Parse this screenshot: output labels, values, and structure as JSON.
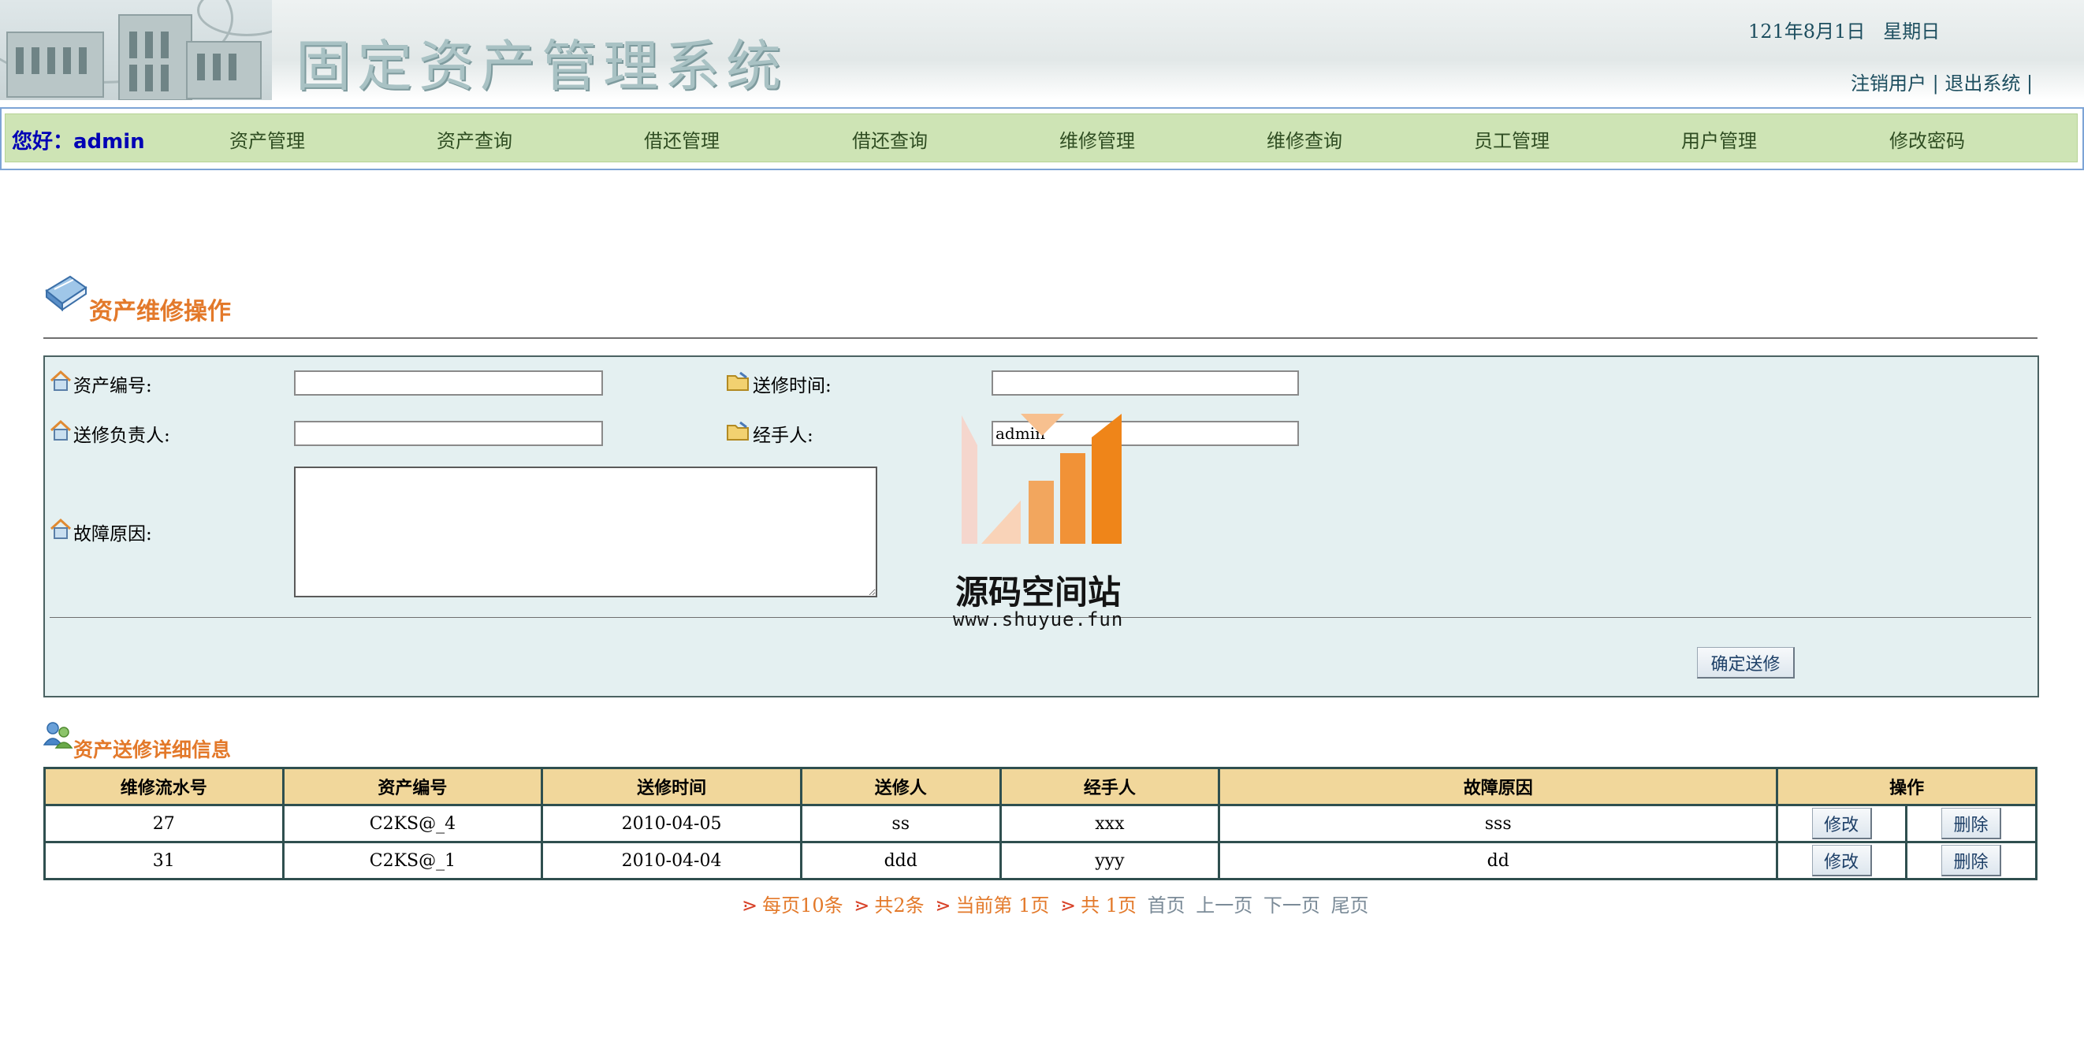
{
  "header": {
    "title": "固定资产管理系统",
    "date": "121年8月1日   星期日",
    "links": [
      "注销用户",
      "退出系统"
    ],
    "link_sep": " | "
  },
  "nav": {
    "greeting": "您好：admin",
    "items": [
      "资产管理",
      "资产查询",
      "借还管理",
      "借还查询",
      "维修管理",
      "维修查询",
      "员工管理",
      "用户管理",
      "修改密码"
    ]
  },
  "form_section": {
    "title": "资产维修操作",
    "fields": {
      "asset_no": {
        "label": "资产编号:",
        "value": ""
      },
      "send_time": {
        "label": "送修时间:",
        "value": ""
      },
      "responsible": {
        "label": "送修负责人:",
        "value": ""
      },
      "handler": {
        "label": "经手人:",
        "value": "admin"
      },
      "fault": {
        "label": "故障原因:",
        "value": ""
      }
    },
    "submit_label": "确定送修"
  },
  "table_section": {
    "title": "资产送修详细信息",
    "columns": [
      "维修流水号",
      "资产编号",
      "送修时间",
      "送修人",
      "经手人",
      "故障原因",
      "操作"
    ],
    "rows": [
      {
        "id": "27",
        "asset": "C2KS@_4",
        "time": "2010-04-05",
        "sender": "ss",
        "handler": "xxx",
        "reason": "sss"
      },
      {
        "id": "31",
        "asset": "C2KS@_1",
        "time": "2010-04-04",
        "sender": "ddd",
        "handler": "yyy",
        "reason": "dd"
      }
    ],
    "edit_label": "修改",
    "delete_label": "删除"
  },
  "pager": {
    "per_page": "每页10条",
    "total": "共2条",
    "current": "当前第 1页",
    "pages": "共 1页",
    "first": "首页",
    "prev": "上一页",
    "next": "下一页",
    "last": "尾页"
  },
  "watermark": {
    "name": "源码空间站",
    "url": "www.shuyue.fun"
  },
  "colors": {
    "nav_bg": "#cee4b5",
    "form_bg": "#e4f0f1",
    "table_header_bg": "#f1d79b",
    "section_title": "#e3792a",
    "greeting": "#0000b5"
  }
}
